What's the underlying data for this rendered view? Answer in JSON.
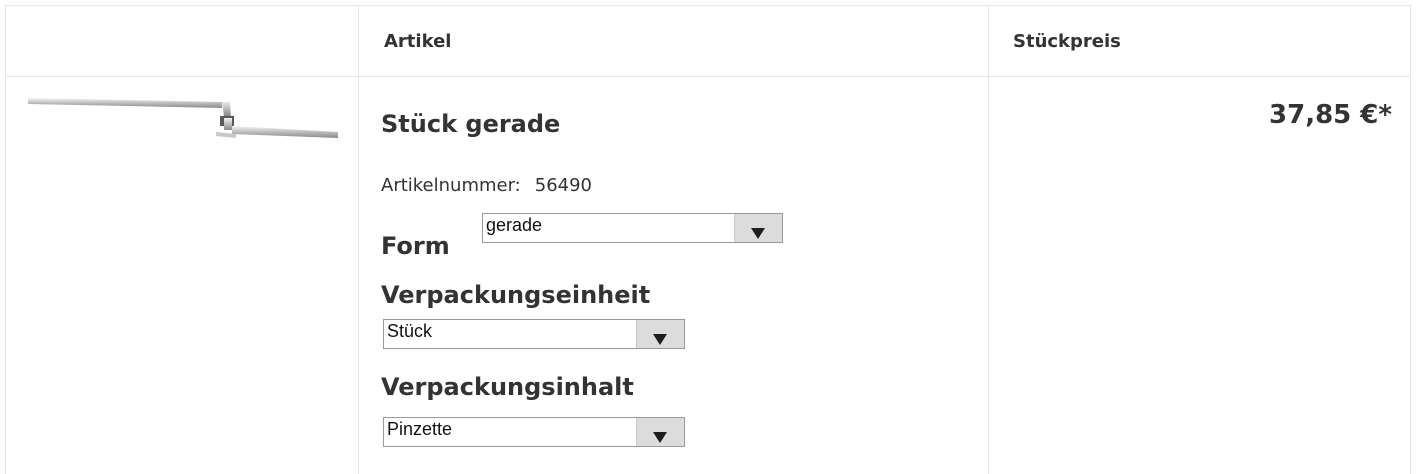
{
  "table": {
    "headers": {
      "image": "",
      "article": "Artikel",
      "unit_price": "Stückpreis"
    }
  },
  "product": {
    "image_icon": "tweezers-product-image",
    "name": "Stück gerade",
    "article_number_label": "Artikelnummer:",
    "article_number": "56490",
    "options": {
      "form": {
        "label": "Form",
        "selected": "gerade"
      },
      "packaging_unit": {
        "label": "Verpackungseinheit",
        "selected": "Stück"
      },
      "packaging_content": {
        "label": "Verpackungsinhalt",
        "selected": "Pinzette"
      }
    },
    "price": "37,85 €*"
  },
  "colors": {
    "border": "#e6e6e6",
    "text": "#333333",
    "select_button": "#dcdcdc"
  }
}
